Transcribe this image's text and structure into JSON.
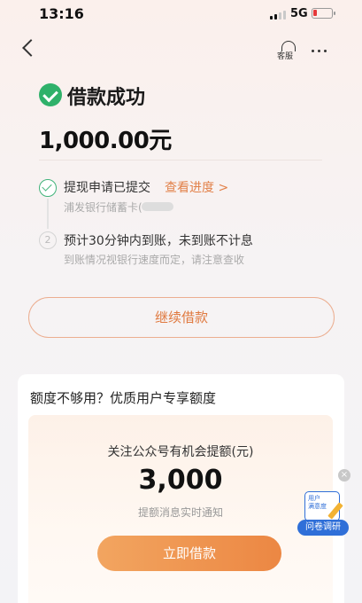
{
  "status_bar": {
    "time": "13:16",
    "network": "5G"
  },
  "nav": {
    "customer_service_label": "客服"
  },
  "result": {
    "title": "借款成功",
    "amount": "1,000.00元"
  },
  "steps": [
    {
      "title": "提现申请已提交",
      "link": "查看进度 >",
      "subtitle": "浦发银行储蓄卡(",
      "state": "done"
    },
    {
      "number": "2",
      "title": "预计30分钟内到账，未到账不计息",
      "subtitle": "到账情况视银行速度而定，请注意查收",
      "state": "pending"
    }
  ],
  "continue_button": "继续借款",
  "promo": {
    "title": "额度不够用？优质用户专享额度",
    "label": "关注公众号有机会提额(元)",
    "amount": "3,000",
    "note": "提额消息实时通知",
    "button": "立即借款"
  },
  "survey": {
    "card_line1": "用户",
    "card_line2": "满意度",
    "tag": "问卷调研",
    "close": "×"
  },
  "colors": {
    "accent": "#e0793f",
    "success": "#2fb16a",
    "survey_blue": "#2f6fd8"
  }
}
